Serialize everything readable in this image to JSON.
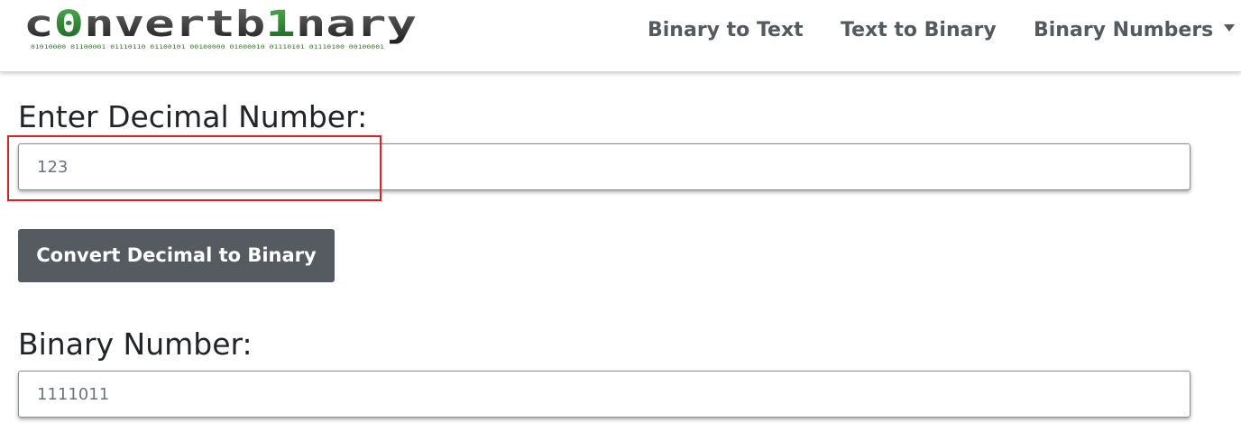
{
  "header": {
    "logo": {
      "text": "c0nvertb1nary",
      "binary_tagline": "01010000 01100001 01110110 01100101 00100000 01000010 01110101 01110100 00100001",
      "colors": {
        "dark": "#2b2b2b",
        "green": "#2e7d1f",
        "accent": "#3a3a3a"
      }
    },
    "nav": [
      {
        "label": "Binary to Text"
      },
      {
        "label": "Text to Binary"
      },
      {
        "label": "Binary Numbers",
        "has_dropdown": true
      }
    ]
  },
  "form": {
    "decimal_label": "Enter Decimal Number:",
    "decimal_value": "123",
    "convert_button": "Convert Decimal to Binary",
    "binary_label": "Binary Number:",
    "binary_value": "1111011"
  },
  "annotation": {
    "highlight_color": "#e02020",
    "highlighted_element": "decimal-input"
  },
  "colors": {
    "nav_text": "#555a5f",
    "button_bg": "#565b61",
    "button_text": "#ffffff",
    "label_text": "#212529",
    "input_text": "#6c757d"
  }
}
